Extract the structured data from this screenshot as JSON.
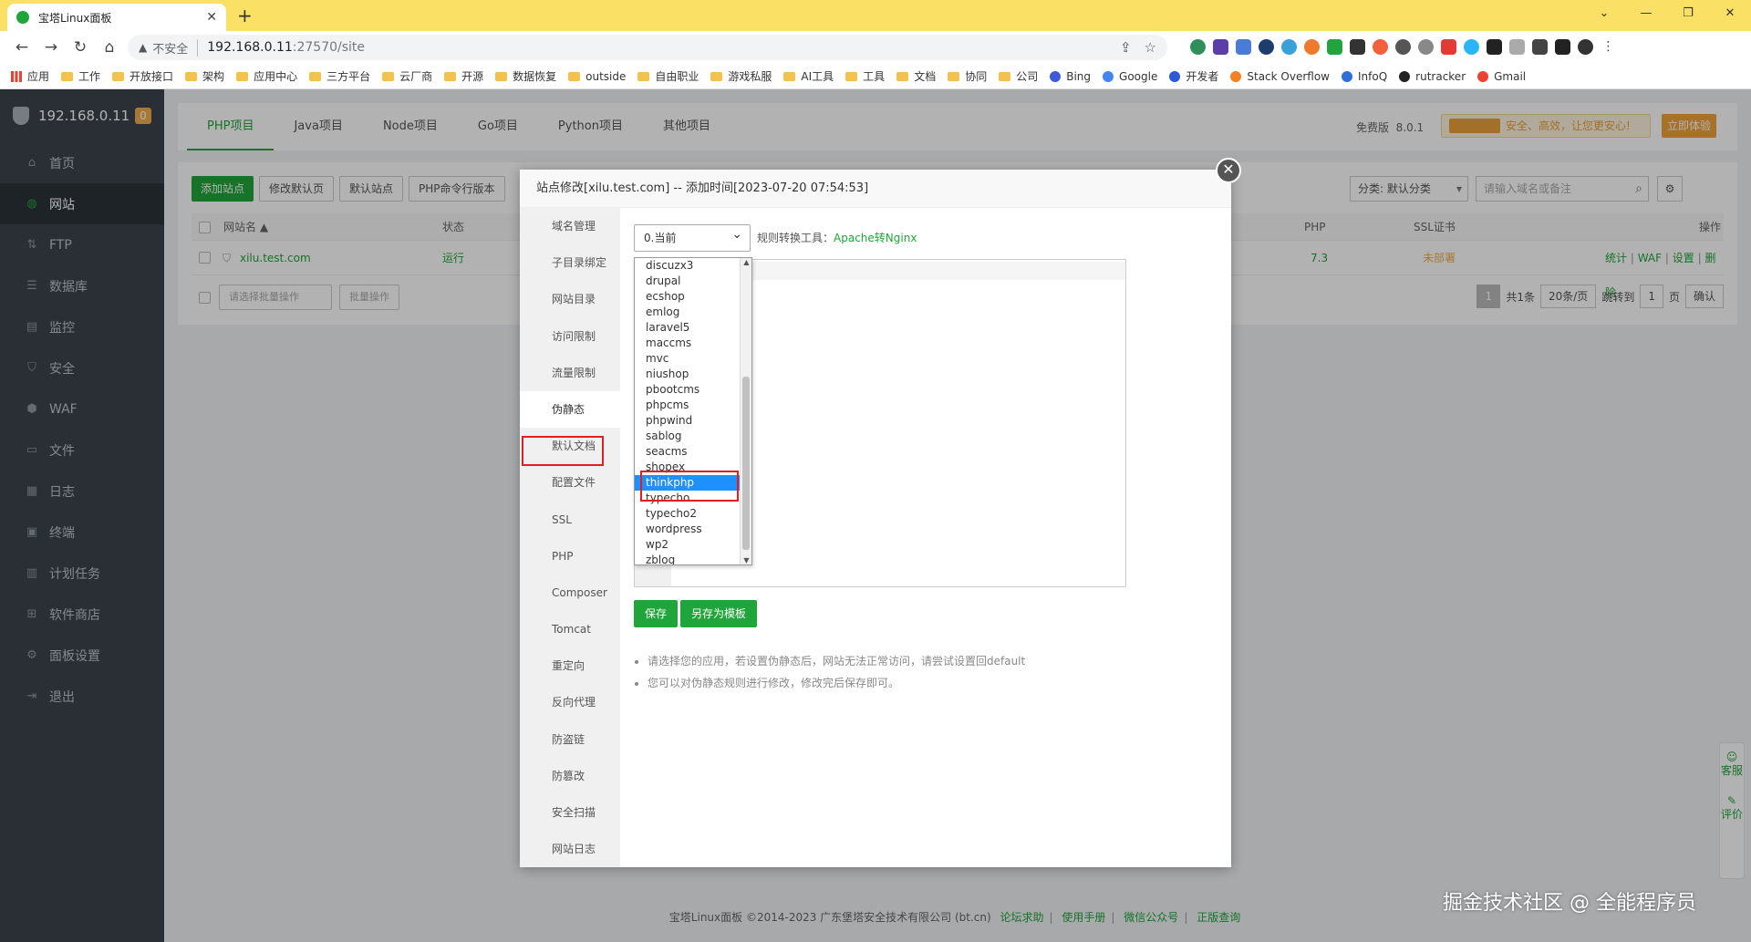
{
  "browser": {
    "tab_title": "宝塔Linux面板",
    "insecure_label": "不安全",
    "url_host": "192.168.0.11",
    "url_rest": ":27570/site",
    "bookmarks": [
      "应用",
      "工作",
      "开放接口",
      "架构",
      "应用中心",
      "三方平台",
      "云厂商",
      "开源",
      "数据恢复",
      "outside",
      "自由职业",
      "游戏私服",
      "AI工具",
      "工具",
      "文档",
      "协同",
      "公司",
      "Bing",
      "Google",
      "开发者",
      "Stack Overflow",
      "InfoQ",
      "rutracker",
      "Gmail"
    ]
  },
  "sidebar": {
    "host": "192.168.0.11",
    "badge": "0",
    "items": [
      {
        "label": "首页",
        "icon": "home-icon",
        "glyph": "⌂"
      },
      {
        "label": "网站",
        "icon": "globe-icon",
        "glyph": "◍"
      },
      {
        "label": "FTP",
        "icon": "ftp-icon",
        "glyph": "⇅"
      },
      {
        "label": "数据库",
        "icon": "database-icon",
        "glyph": "☰"
      },
      {
        "label": "监控",
        "icon": "monitor-icon",
        "glyph": "▤"
      },
      {
        "label": "安全",
        "icon": "shield-icon",
        "glyph": "⛉"
      },
      {
        "label": "WAF",
        "icon": "waf-icon",
        "glyph": "⬢"
      },
      {
        "label": "文件",
        "icon": "folder-icon",
        "glyph": "▭"
      },
      {
        "label": "日志",
        "icon": "log-icon",
        "glyph": "▦"
      },
      {
        "label": "终端",
        "icon": "terminal-icon",
        "glyph": "▣"
      },
      {
        "label": "计划任务",
        "icon": "calendar-icon",
        "glyph": "▥"
      },
      {
        "label": "软件商店",
        "icon": "apps-icon",
        "glyph": "⊞"
      },
      {
        "label": "面板设置",
        "icon": "settings-icon",
        "glyph": "⚙"
      },
      {
        "label": "退出",
        "icon": "logout-icon",
        "glyph": "⇥"
      }
    ]
  },
  "topbar": {
    "tabs": [
      "PHP项目",
      "Java项目",
      "Node项目",
      "Go项目",
      "Python项目",
      "其他项目"
    ],
    "version_label": "免费版",
    "version": "8.0.1",
    "promo": "安全、高效，让您更安心!",
    "try_label": "立即体验"
  },
  "site_list": {
    "buttons": [
      "添加站点",
      "修改默认页",
      "默认站点",
      "PHP命令行版本"
    ],
    "category": "分类: 默认分类",
    "search_placeholder": "请输入域名或备注",
    "headers": {
      "name": "网站名 ▲",
      "status": "状态",
      "php": "PHP",
      "ssl": "SSL证书",
      "ops": "操作"
    },
    "row": {
      "name": "xilu.test.com",
      "status": "运行",
      "php": "7.3",
      "ssl": "未部署",
      "ops": [
        "统计",
        "WAF",
        "设置",
        "删除"
      ]
    },
    "batch_placeholder": "请选择批量操作",
    "batch_button": "批量操作",
    "pager": {
      "page": "1",
      "total": "共1条",
      "per_page": "20条/页",
      "jump_label": "跳转到",
      "jump_value": "1",
      "page_unit": "页",
      "confirm": "确认"
    }
  },
  "dialog": {
    "title": "站点修改[xilu.test.com] -- 添加时间[2023-07-20 07:54:53]",
    "nav": [
      "域名管理",
      "子目录绑定",
      "网站目录",
      "访问限制",
      "流量限制",
      "伪静态",
      "默认文档",
      "配置文件",
      "SSL",
      "PHP",
      "Composer",
      "Tomcat",
      "重定向",
      "反向代理",
      "防盗链",
      "防篡改",
      "安全扫描",
      "网站日志"
    ],
    "select_value": "0.当前",
    "convert_label": "规则转换工具：",
    "convert_link": "Apache转Nginx",
    "options": [
      "discuzx3",
      "drupal",
      "ecshop",
      "emlog",
      "laravel5",
      "maccms",
      "mvc",
      "niushop",
      "pbootcms",
      "phpcms",
      "phpwind",
      "sablog",
      "seacms",
      "shopex",
      "thinkphp",
      "typecho",
      "typecho2",
      "wordpress",
      "wp2",
      "zblog"
    ],
    "selected_option": "thinkphp",
    "save_label": "保存",
    "save_template_label": "另存为模板",
    "tips": [
      "请选择您的应用，若设置伪静态后，网站无法正常访问，请尝试设置回default",
      "您可以对伪静态规则进行修改，修改完后保存即可。"
    ]
  },
  "footer": {
    "copyright": "宝塔Linux面板 ©2014-2023 广东堡塔安全技术有限公司 (bt.cn)",
    "links": [
      "论坛求助",
      "使用手册",
      "微信公众号",
      "正版查询"
    ]
  },
  "service": {
    "chat": "客服",
    "review": "评价"
  },
  "watermark": "掘金技术社区 @ 全能程序员"
}
